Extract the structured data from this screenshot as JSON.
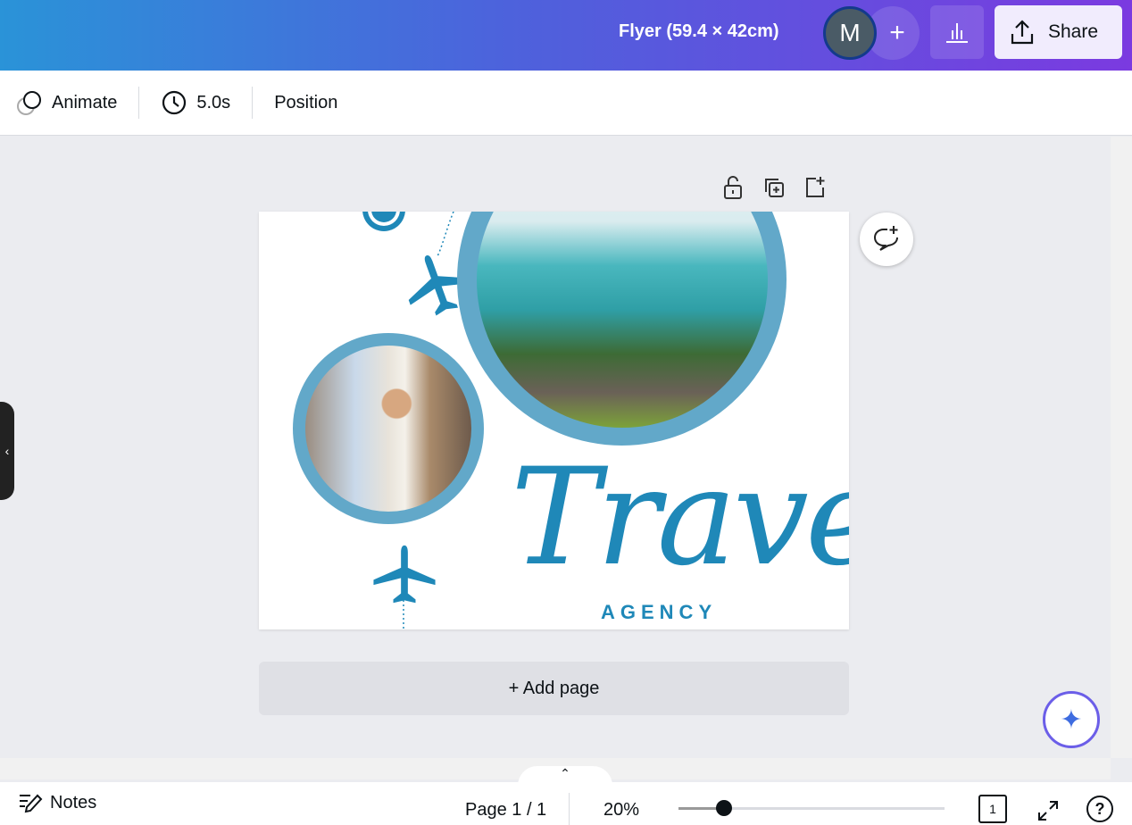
{
  "header": {
    "title": "Flyer (59.4 × 42cm)",
    "avatar_initial": "M",
    "add_collaborator": "+",
    "share_label": "Share"
  },
  "toolbar": {
    "animate": "Animate",
    "duration": "5.0s",
    "position": "Position"
  },
  "design": {
    "title_text": "Travel",
    "subtitle_text": "AGENCY",
    "accent": "#1f88b8",
    "ring": "#62a8c9"
  },
  "add_page": "+ Add page",
  "footer": {
    "notes": "Notes",
    "page": "Page 1 / 1",
    "zoom": "20%",
    "zoom_slider_fraction": 0.17,
    "page_count": "1",
    "help": "?"
  }
}
